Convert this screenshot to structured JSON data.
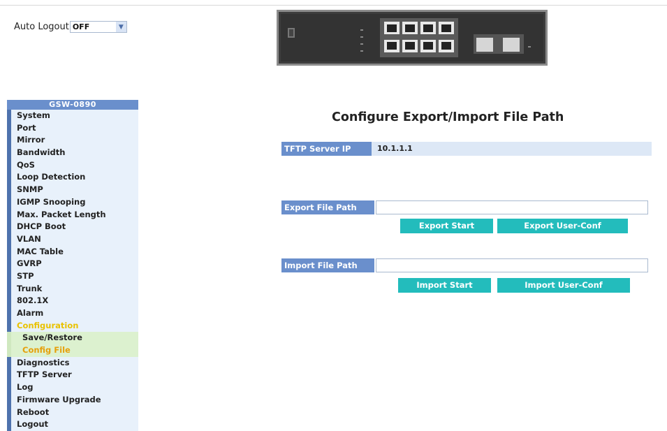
{
  "header": {
    "auto_logout_label": "Auto Logout",
    "auto_logout_value": "OFF"
  },
  "sidebar": {
    "title": "GSW-0890",
    "items": [
      {
        "label": "System"
      },
      {
        "label": "Port"
      },
      {
        "label": "Mirror"
      },
      {
        "label": "Bandwidth"
      },
      {
        "label": "QoS"
      },
      {
        "label": "Loop Detection"
      },
      {
        "label": "SNMP"
      },
      {
        "label": "IGMP Snooping"
      },
      {
        "label": "Max. Packet Length"
      },
      {
        "label": "DHCP Boot"
      },
      {
        "label": "VLAN"
      },
      {
        "label": "MAC Table"
      },
      {
        "label": "GVRP"
      },
      {
        "label": "STP"
      },
      {
        "label": "Trunk"
      },
      {
        "label": "802.1X"
      },
      {
        "label": "Alarm"
      },
      {
        "label": "Configuration"
      },
      {
        "label": "Save/Restore"
      },
      {
        "label": "Config File"
      },
      {
        "label": "Diagnostics"
      },
      {
        "label": "TFTP Server"
      },
      {
        "label": "Log"
      },
      {
        "label": "Firmware Upgrade"
      },
      {
        "label": "Reboot"
      },
      {
        "label": "Logout"
      }
    ]
  },
  "main": {
    "title": "Configure Export/Import File Path",
    "tftp_label": "TFTP Server IP",
    "tftp_value": "10.1.1.1",
    "export_label": "Export File Path",
    "export_value": "",
    "export_start": "Export Start",
    "export_user_conf": "Export User-Conf",
    "import_label": "Import File Path",
    "import_value": "",
    "import_start": "Import Start",
    "import_user_conf": "Import User-Conf"
  },
  "colors": {
    "menu_bg": "#e8f1fb",
    "menu_border": "#4e72ad",
    "header_blue": "#6a8fcc",
    "button_teal": "#23bcbc",
    "active_yellow": "#e9c200",
    "current_orange": "#e6a00b",
    "submenu_green": "#dcf1cf"
  }
}
